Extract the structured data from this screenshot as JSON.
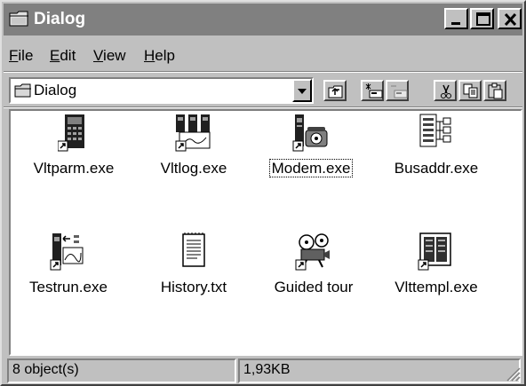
{
  "window": {
    "title": "Dialog",
    "icon": "folder-icon"
  },
  "title_buttons": [
    "minimize-icon",
    "maximize-icon",
    "close-icon"
  ],
  "menu": [
    {
      "label": "File",
      "accel": "F"
    },
    {
      "label": "Edit",
      "accel": "E"
    },
    {
      "label": "View",
      "accel": "V"
    },
    {
      "label": "Help",
      "accel": "H"
    }
  ],
  "address": {
    "value": "Dialog",
    "icon": "folder-icon"
  },
  "toolbar": [
    "up-one-level-icon",
    "map-drive-icon",
    "disconnect-drive-icon",
    "cut-icon",
    "copy-icon",
    "paste-icon"
  ],
  "files": [
    {
      "name": "Vltparm.exe",
      "icon": "device-icon"
    },
    {
      "name": "Vltlog.exe",
      "icon": "log-chart-icon"
    },
    {
      "name": "Modem.exe",
      "icon": "modem-icon",
      "focused": true
    },
    {
      "name": "Busaddr.exe",
      "icon": "bus-address-icon"
    },
    {
      "name": "Testrun.exe",
      "icon": "test-run-icon"
    },
    {
      "name": "History.txt",
      "icon": "text-document-icon"
    },
    {
      "name": "Guided tour",
      "icon": "projector-icon"
    },
    {
      "name": "Vlttempl.exe",
      "icon": "template-icon"
    }
  ],
  "status": {
    "objects": "8 object(s)",
    "size": "1,93KB"
  }
}
